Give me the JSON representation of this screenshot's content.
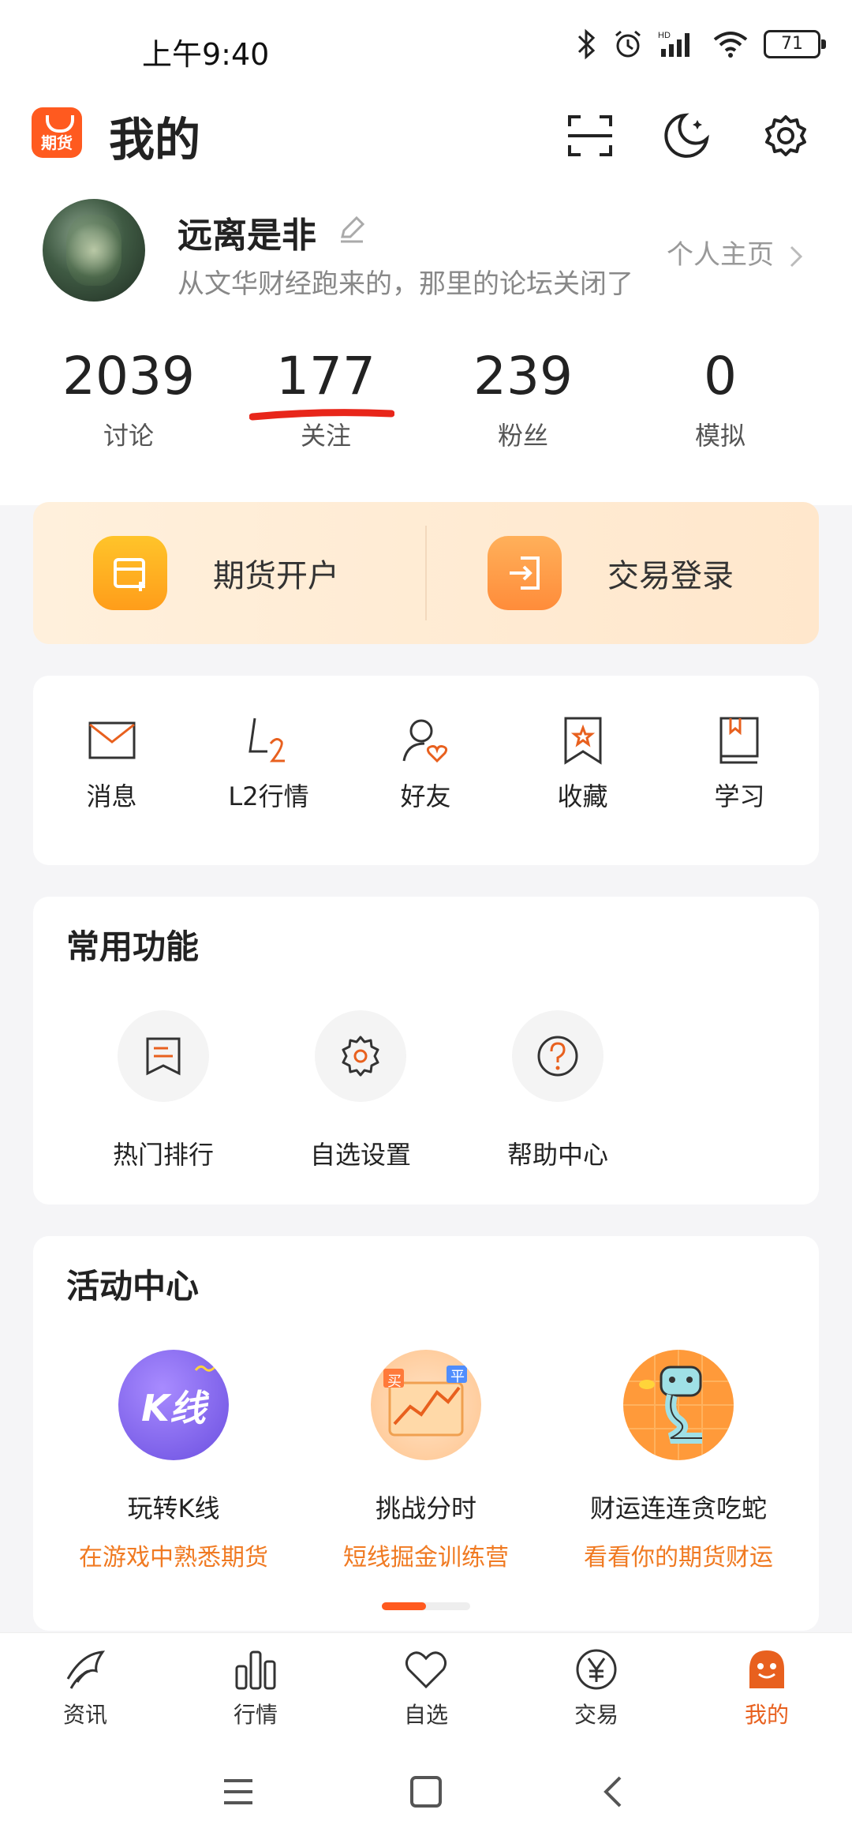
{
  "status_bar": {
    "time": "上午9:40",
    "battery": "71"
  },
  "header": {
    "logo_text": "期货",
    "title": "我的"
  },
  "profile": {
    "name": "远离是非",
    "bio": "从文华财经跑来的，那里的论坛关闭了",
    "homepage_link": "个人主页"
  },
  "stats": [
    {
      "value": "2039",
      "label": "讨论"
    },
    {
      "value": "177",
      "label": "关注"
    },
    {
      "value": "239",
      "label": "粉丝"
    },
    {
      "value": "0",
      "label": "模拟"
    }
  ],
  "account_actions": {
    "open_account": "期货开户",
    "trade_login": "交易登录"
  },
  "quick_items": [
    {
      "label": "消息",
      "icon": "mail-icon"
    },
    {
      "label": "L2行情",
      "icon": "l2-icon"
    },
    {
      "label": "好友",
      "icon": "friend-icon"
    },
    {
      "label": "收藏",
      "icon": "bookmark-icon"
    },
    {
      "label": "学习",
      "icon": "book-icon"
    }
  ],
  "common_functions": {
    "title": "常用功能",
    "items": [
      {
        "label": "热门排行",
        "icon": "ranking-icon"
      },
      {
        "label": "自选设置",
        "icon": "gear-icon"
      },
      {
        "label": "帮助中心",
        "icon": "help-icon"
      }
    ]
  },
  "activity_center": {
    "title": "活动中心",
    "items": [
      {
        "title": "玩转K线",
        "subtitle": "在游戏中熟悉期货",
        "badge": "K线"
      },
      {
        "title": "挑战分时",
        "subtitle": "短线掘金训练营",
        "badge_left": "买",
        "badge_right": "平"
      },
      {
        "title": "财运连连贪吃蛇",
        "subtitle": "看看你的期货财运"
      }
    ]
  },
  "tabs": [
    {
      "label": "资讯",
      "icon": "news-icon"
    },
    {
      "label": "行情",
      "icon": "chart-icon"
    },
    {
      "label": "自选",
      "icon": "heart-icon"
    },
    {
      "label": "交易",
      "icon": "yuan-icon"
    },
    {
      "label": "我的",
      "icon": "me-icon",
      "active": true
    }
  ],
  "colors": {
    "accent": "#ff5a1f",
    "orange_text": "#f07a22",
    "active_tab": "#e8601e"
  }
}
